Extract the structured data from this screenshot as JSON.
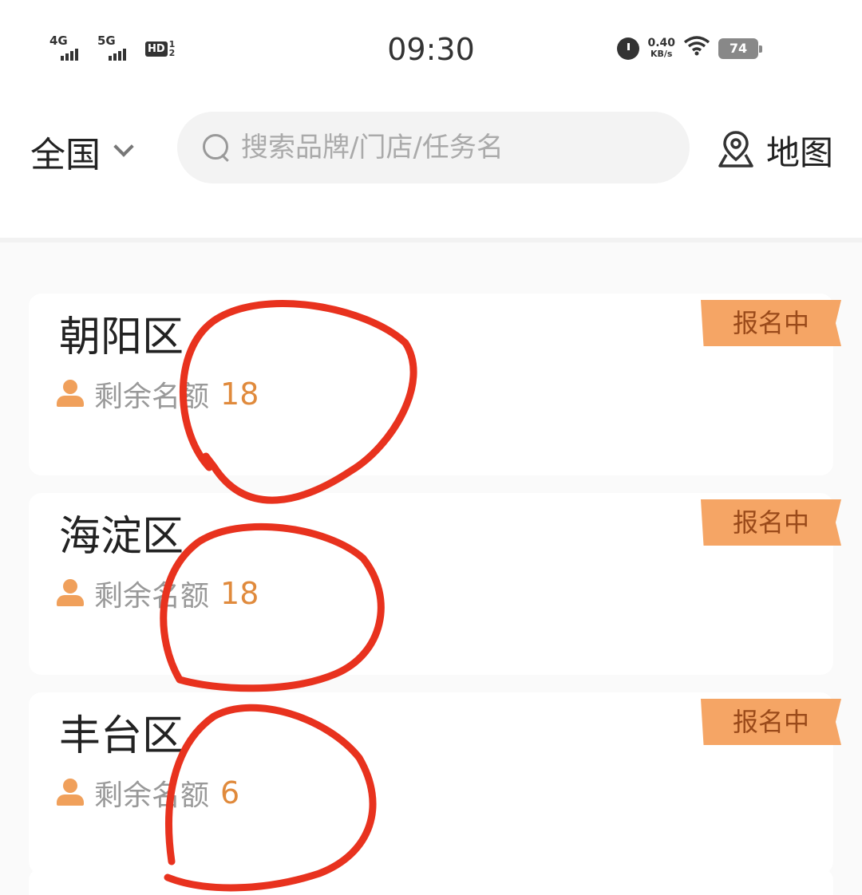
{
  "status_bar": {
    "net1": "4G",
    "net2": "5G",
    "hd": "HD",
    "hd_top": "1",
    "hd_bottom": "2",
    "time": "09:30",
    "speed_value": "0.40",
    "speed_unit": "KB/s",
    "battery": "74"
  },
  "header": {
    "region": "全国",
    "search_placeholder": "搜索品牌/门店/任务名",
    "map_label": "地图"
  },
  "regions": [
    {
      "name": "朝阳区",
      "quota_label": "剩余名额",
      "quota_count": "18",
      "status": "报名中"
    },
    {
      "name": "海淀区",
      "quota_label": "剩余名额",
      "quota_count": "18",
      "status": "报名中"
    },
    {
      "name": "丰台区",
      "quota_label": "剩余名额",
      "quota_count": "6",
      "status": "报名中"
    }
  ],
  "colors": {
    "accent": "#f5a565",
    "count": "#e08a3c",
    "annotation": "#e8321e"
  }
}
